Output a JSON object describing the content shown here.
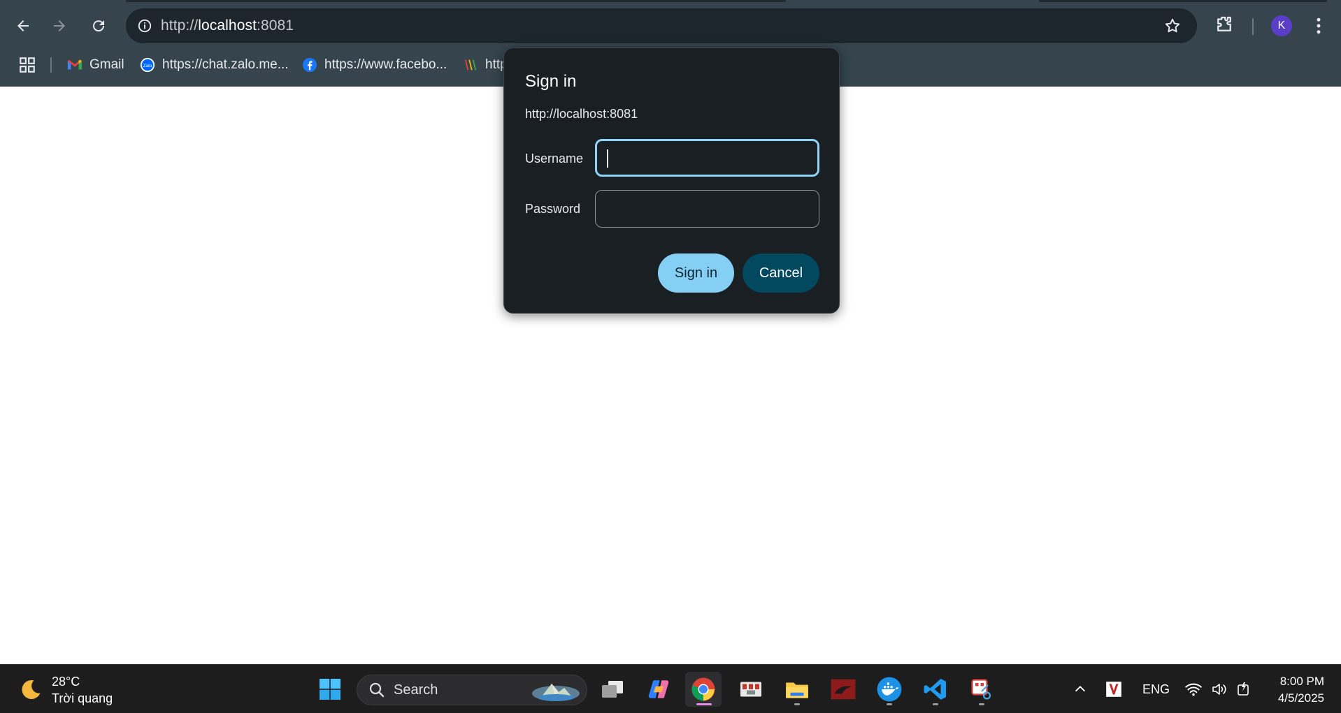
{
  "browser": {
    "url_scheme": "http://",
    "url_host": "localhost",
    "url_port": ":8081",
    "profile_initial": "K",
    "bookmarks": [
      {
        "label": "Gmail",
        "icon": "gmail-icon"
      },
      {
        "label": "https://chat.zalo.me...",
        "icon": "zalo-icon"
      },
      {
        "label": "https://www.facebo...",
        "icon": "facebook-icon"
      },
      {
        "label": "http",
        "icon": "site-icon"
      }
    ]
  },
  "dialog": {
    "title": "Sign in",
    "origin": "http://localhost:8081",
    "username_label": "Username",
    "password_label": "Password",
    "username_value": "",
    "password_value": "",
    "submit_label": "Sign in",
    "cancel_label": "Cancel"
  },
  "taskbar": {
    "weather_temp": "28°C",
    "weather_desc": "Trời quang",
    "search_placeholder": "Search",
    "language": "ENG",
    "time": "8:00 PM",
    "date": "4/5/2025",
    "apps": [
      "start-icon",
      "task-view-icon",
      "copilot-icon",
      "chrome-icon",
      "app-icon",
      "file-explorer-icon",
      "kali-icon",
      "docker-icon",
      "vscode-icon",
      "snipping-tool-icon"
    ]
  },
  "colors": {
    "chrome_toolbar": "#35444d",
    "dialog_bg": "#1a1f23",
    "primary_button": "#86cff4",
    "cancel_button": "#02485e",
    "focus_ring": "#8fd3f7",
    "taskbar": "#1d1d1e"
  }
}
